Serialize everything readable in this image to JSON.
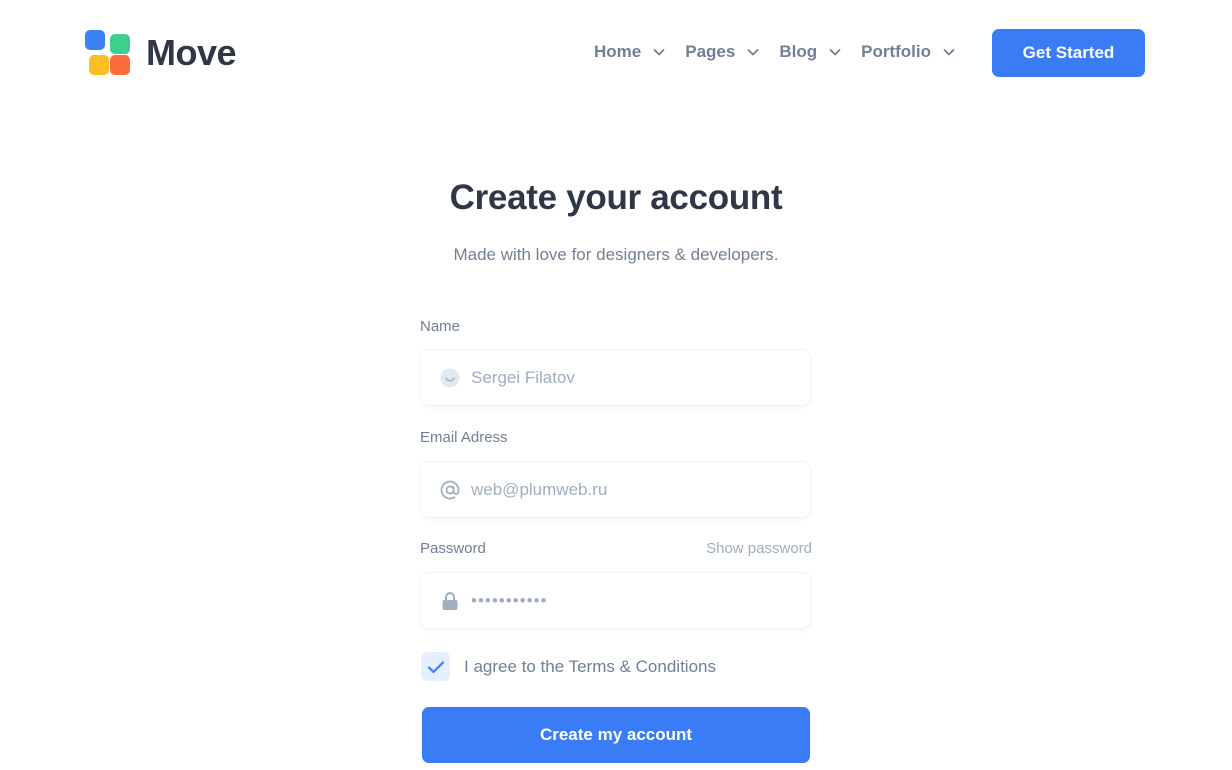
{
  "colors": {
    "accent": "#3a7cf6",
    "logo_blue": "#3b82f6",
    "logo_green": "#3ecf8e",
    "logo_yellow": "#fbbf24",
    "logo_red": "#fb6c3a"
  },
  "header": {
    "brand": "Move",
    "nav": [
      {
        "label": "Home",
        "icon": "chevron-down-icon"
      },
      {
        "label": "Pages",
        "icon": "chevron-down-icon"
      },
      {
        "label": "Blog",
        "icon": "chevron-down-icon"
      },
      {
        "label": "Portfolio",
        "icon": "chevron-down-icon"
      }
    ],
    "cta_label": "Get Started"
  },
  "form": {
    "title": "Create your account",
    "subtitle": "Made with love for designers & developers.",
    "name": {
      "label": "Name",
      "placeholder": "Sergei Filatov",
      "icon": "smile-icon"
    },
    "email": {
      "label": "Email Adress",
      "placeholder": "web@plumweb.ru",
      "icon": "at-icon"
    },
    "password": {
      "label": "Password",
      "show_label": "Show password",
      "masked_value": "•••••••••••",
      "icon": "lock-icon"
    },
    "agree": {
      "checked": true,
      "label": "I agree to the Terms & Conditions"
    },
    "submit_label": "Create my account"
  }
}
